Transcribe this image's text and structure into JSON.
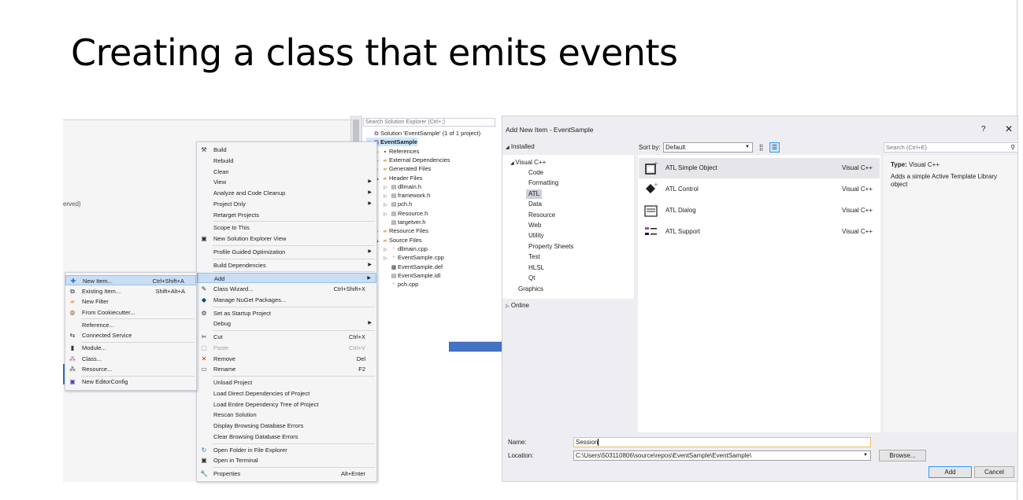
{
  "slide": {
    "title": "Creating a class that emits events"
  },
  "vs_background": {
    "partial_text": "erved)"
  },
  "solution_explorer": {
    "search_placeholder": "Search Solution Explorer (Ctrl+;)",
    "items": [
      {
        "label": "Solution 'EventSample' (1 of 1 project)",
        "icon": "solution-icon",
        "twisty": "",
        "indent": 0
      },
      {
        "label": "EventSample",
        "icon": "project-icon",
        "twisty": "▲",
        "indent": 0,
        "selected": true
      },
      {
        "label": "References",
        "icon": "references-icon",
        "twisty": "▷",
        "indent": 1
      },
      {
        "label": "External Dependencies",
        "icon": "folder-icon",
        "twisty": "▷",
        "indent": 1
      },
      {
        "label": "Generated Files",
        "icon": "folder-icon",
        "twisty": "▷",
        "indent": 1
      },
      {
        "label": "Header Files",
        "icon": "folder-icon",
        "twisty": "▲",
        "indent": 1
      },
      {
        "label": "dllmain.h",
        "icon": "header-file-icon",
        "twisty": "▷",
        "indent": 2
      },
      {
        "label": "framework.h",
        "icon": "header-file-icon",
        "twisty": "▷",
        "indent": 2
      },
      {
        "label": "pch.h",
        "icon": "header-file-icon",
        "twisty": "▷",
        "indent": 2
      },
      {
        "label": "Resource.h",
        "icon": "header-file-icon",
        "twisty": "▷",
        "indent": 2
      },
      {
        "label": "targetver.h",
        "icon": "header-file-icon",
        "twisty": "",
        "indent": 2
      },
      {
        "label": "Resource Files",
        "icon": "folder-icon",
        "twisty": "▷",
        "indent": 1
      },
      {
        "label": "Source Files",
        "icon": "folder-icon",
        "twisty": "▲",
        "indent": 1
      },
      {
        "label": "dllmain.cpp",
        "icon": "cpp-file-icon",
        "twisty": "▷",
        "indent": 2
      },
      {
        "label": "EventSample.cpp",
        "icon": "cpp-file-icon",
        "twisty": "▷",
        "indent": 2
      },
      {
        "label": "EventSample.def",
        "icon": "def-file-icon",
        "twisty": "",
        "indent": 2
      },
      {
        "label": "EventSample.idl",
        "icon": "idl-file-icon",
        "twisty": "",
        "indent": 2
      },
      {
        "label": "pch.cpp",
        "icon": "cpp-file-icon",
        "twisty": "",
        "indent": 2
      }
    ]
  },
  "context_menu": {
    "items": [
      {
        "label": "Build",
        "icon": "build-icon",
        "shortcut": "",
        "arrow": false
      },
      {
        "label": "Rebuild",
        "icon": "",
        "shortcut": "",
        "arrow": false
      },
      {
        "label": "Clean",
        "icon": "",
        "shortcut": "",
        "arrow": false
      },
      {
        "label": "View",
        "icon": "",
        "shortcut": "",
        "arrow": true
      },
      {
        "label": "Analyze and Code Cleanup",
        "icon": "",
        "shortcut": "",
        "arrow": true
      },
      {
        "label": "Project Only",
        "icon": "",
        "shortcut": "",
        "arrow": true
      },
      {
        "label": "Retarget Projects",
        "icon": "",
        "shortcut": "",
        "arrow": false,
        "sep_after": true
      },
      {
        "label": "Scope to This",
        "icon": "",
        "shortcut": "",
        "arrow": false
      },
      {
        "label": "New Solution Explorer View",
        "icon": "new-view-icon",
        "shortcut": "",
        "arrow": false,
        "sep_after": true
      },
      {
        "label": "Profile Guided Optimization",
        "icon": "",
        "shortcut": "",
        "arrow": true,
        "sep_after": true
      },
      {
        "label": "Build Dependencies",
        "icon": "",
        "shortcut": "",
        "arrow": true,
        "sep_after": true
      },
      {
        "label": "Add",
        "icon": "",
        "shortcut": "",
        "arrow": true,
        "highlighted": true
      },
      {
        "label": "Class Wizard...",
        "icon": "class-wizard-icon",
        "shortcut": "Ctrl+Shift+X",
        "arrow": false
      },
      {
        "label": "Manage NuGet Packages...",
        "icon": "nuget-icon",
        "shortcut": "",
        "arrow": false,
        "sep_after": true
      },
      {
        "label": "Set as Startup Project",
        "icon": "gear-icon",
        "shortcut": "",
        "arrow": false
      },
      {
        "label": "Debug",
        "icon": "",
        "shortcut": "",
        "arrow": true,
        "sep_after": true
      },
      {
        "label": "Cut",
        "icon": "cut-icon",
        "shortcut": "Ctrl+X",
        "arrow": false
      },
      {
        "label": "Paste",
        "icon": "paste-icon",
        "shortcut": "Ctrl+V",
        "arrow": false,
        "disabled": true
      },
      {
        "label": "Remove",
        "icon": "remove-icon",
        "shortcut": "Del",
        "arrow": false
      },
      {
        "label": "Rename",
        "icon": "rename-icon",
        "shortcut": "F2",
        "arrow": false,
        "sep_after": true
      },
      {
        "label": "Unload Project",
        "icon": "",
        "shortcut": "",
        "arrow": false
      },
      {
        "label": "Load Direct Dependencies of Project",
        "icon": "",
        "shortcut": "",
        "arrow": false
      },
      {
        "label": "Load Entire Dependency Tree of Project",
        "icon": "",
        "shortcut": "",
        "arrow": false
      },
      {
        "label": "Rescan Solution",
        "icon": "",
        "shortcut": "",
        "arrow": false
      },
      {
        "label": "Display Browsing Database Errors",
        "icon": "",
        "shortcut": "",
        "arrow": false
      },
      {
        "label": "Clear Browsing Database Errors",
        "icon": "",
        "shortcut": "",
        "arrow": false,
        "sep_after": true
      },
      {
        "label": "Open Folder in File Explorer",
        "icon": "open-folder-icon",
        "shortcut": "",
        "arrow": false
      },
      {
        "label": "Open in Terminal",
        "icon": "terminal-icon",
        "shortcut": "",
        "arrow": false,
        "sep_after": true
      },
      {
        "label": "Properties",
        "icon": "wrench-icon",
        "shortcut": "Alt+Enter",
        "arrow": false
      }
    ]
  },
  "add_submenu": {
    "items": [
      {
        "label": "New Item...",
        "icon": "new-item-icon",
        "shortcut": "Ctrl+Shift+A",
        "highlighted": true
      },
      {
        "label": "Existing Item...",
        "icon": "existing-item-icon",
        "shortcut": "Shift+Alt+A"
      },
      {
        "label": "New Filter",
        "icon": "folder-icon",
        "shortcut": ""
      },
      {
        "label": "From Cookiecutter...",
        "icon": "cookiecutter-icon",
        "shortcut": "",
        "sep_after": true
      },
      {
        "label": "Reference...",
        "icon": "",
        "shortcut": ""
      },
      {
        "label": "Connected Service",
        "icon": "connected-service-icon",
        "shortcut": "",
        "sep_after": true
      },
      {
        "label": "Module...",
        "icon": "module-icon",
        "shortcut": ""
      },
      {
        "label": "Class...",
        "icon": "class-icon",
        "shortcut": ""
      },
      {
        "label": "Resource...",
        "icon": "resource-icon",
        "shortcut": "",
        "sep_after": true
      },
      {
        "label": "New EditorConfig",
        "icon": "editorconfig-icon",
        "shortcut": ""
      }
    ]
  },
  "dialog": {
    "title": "Add New Item - EventSample",
    "help_glyph": "?",
    "close_glyph": "✕",
    "installed_label": "Installed",
    "online_label": "Online",
    "sort_label": "Sort by:",
    "sort_value": "Default",
    "search_placeholder": "Search (Ctrl+E)",
    "tree": {
      "root": "Visual C++",
      "children": [
        "Code",
        "Formatting",
        "ATL",
        "Data",
        "Resource",
        "Web",
        "Utility",
        "Property Sheets",
        "Test",
        "HLSL",
        "Qt"
      ],
      "selected": "ATL",
      "sibling": "Graphics"
    },
    "templates": [
      {
        "name": "ATL Simple Object",
        "type": "Visual C++",
        "icon": "atl-simple-object-icon",
        "selected": true
      },
      {
        "name": "ATL Control",
        "type": "Visual C++",
        "icon": "atl-control-icon"
      },
      {
        "name": "ATL Dialog",
        "type": "Visual C++",
        "icon": "atl-dialog-icon"
      },
      {
        "name": "ATL Support",
        "type": "Visual C++",
        "icon": "atl-support-icon"
      }
    ],
    "details": {
      "type_label": "Type:",
      "type_value": "Visual C++",
      "description": "Adds a simple Active Template Library object"
    },
    "name_label": "Name:",
    "name_value": "Session",
    "location_label": "Location:",
    "location_value": "C:\\Users\\503110806\\source\\repos\\EventSample\\EventSample\\",
    "browse_label": "Browse...",
    "add_label": "Add",
    "cancel_label": "Cancel"
  },
  "colors": {
    "arrow": "#4472c4",
    "highlight": "#c9def5",
    "selection": "#cce8ff"
  }
}
